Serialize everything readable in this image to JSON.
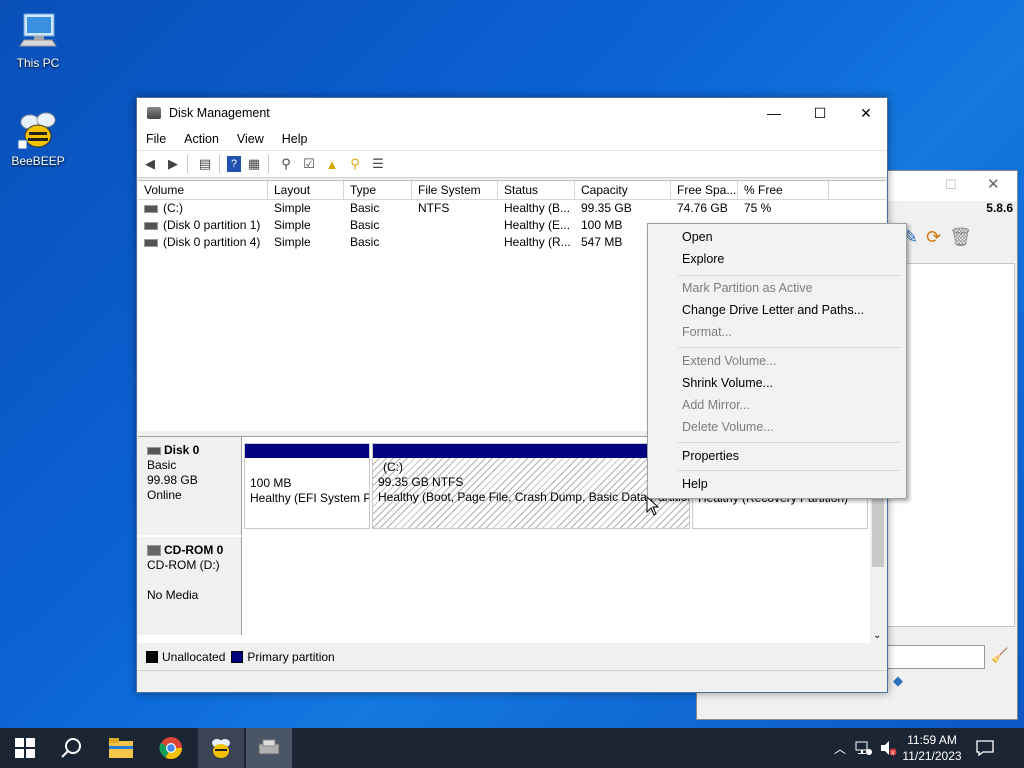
{
  "desktop": {
    "icons": [
      {
        "label": "This PC"
      },
      {
        "label": "BeeBEEP"
      }
    ]
  },
  "background_window": {
    "version": "5.8.6"
  },
  "disk_management": {
    "title": "Disk Management",
    "menu": [
      "File",
      "Action",
      "View",
      "Help"
    ],
    "columns": [
      "Volume",
      "Layout",
      "Type",
      "File System",
      "Status",
      "Capacity",
      "Free Spa...",
      "% Free"
    ],
    "rows": [
      {
        "volume": "(C:)",
        "layout": "Simple",
        "type": "Basic",
        "fs": "NTFS",
        "status": "Healthy (B...",
        "capacity": "99.35 GB",
        "free": "74.76 GB",
        "pct": "75 %"
      },
      {
        "volume": "(Disk 0 partition 1)",
        "layout": "Simple",
        "type": "Basic",
        "fs": "",
        "status": "Healthy (E...",
        "capacity": "100 MB",
        "free": "",
        "pct": ""
      },
      {
        "volume": "(Disk 0 partition 4)",
        "layout": "Simple",
        "type": "Basic",
        "fs": "",
        "status": "Healthy (R...",
        "capacity": "547 MB",
        "free": "",
        "pct": ""
      }
    ],
    "disk0": {
      "name": "Disk 0",
      "type": "Basic",
      "size": "99.98 GB",
      "state": "Online",
      "partitions": [
        {
          "size": "100 MB",
          "status": "Healthy (EFI System P"
        },
        {
          "name": "(C:)",
          "size": "99.35 GB NTFS",
          "status": "Healthy (Boot, Page File, Crash Dump, Basic Data Partition"
        },
        {
          "status": "Healthy (Recovery Partition)"
        }
      ]
    },
    "cdrom": {
      "name": "CD-ROM 0",
      "type": "CD-ROM (D:)",
      "media": "No Media"
    },
    "legend": [
      {
        "label": "Unallocated",
        "color": "#000000"
      },
      {
        "label": "Primary partition",
        "color": "#000080"
      }
    ]
  },
  "context_menu": {
    "items": [
      {
        "label": "Open",
        "enabled": true
      },
      {
        "label": "Explore",
        "enabled": true
      },
      {
        "label": "Mark Partition as Active",
        "enabled": false
      },
      {
        "label": "Change Drive Letter and Paths...",
        "enabled": true
      },
      {
        "label": "Format...",
        "enabled": false
      },
      {
        "label": "Extend Volume...",
        "enabled": false
      },
      {
        "label": "Shrink Volume...",
        "enabled": true
      },
      {
        "label": "Add Mirror...",
        "enabled": false
      },
      {
        "label": "Delete Volume...",
        "enabled": false
      },
      {
        "label": "Properties",
        "enabled": true
      },
      {
        "label": "Help",
        "enabled": true
      }
    ]
  },
  "taskbar": {
    "time": "11:59 AM",
    "date": "11/21/2023"
  }
}
